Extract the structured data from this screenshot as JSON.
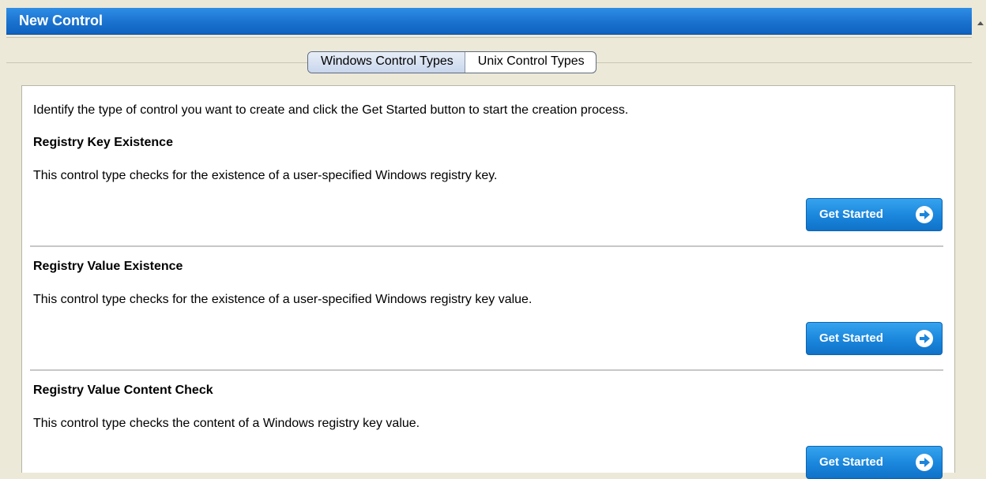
{
  "window": {
    "title": "New Control"
  },
  "tabs": [
    {
      "label": "Windows Control Types",
      "active": true
    },
    {
      "label": "Unix Control Types",
      "active": false
    }
  ],
  "intro": "Identify the type of control you want to create and click the Get Started button to start the creation process.",
  "controls": [
    {
      "heading": "Registry Key Existence",
      "description": "This control type checks for the existence of a user-specified Windows registry key.",
      "button_label": "Get Started"
    },
    {
      "heading": "Registry Value Existence",
      "description": "This control type checks for the existence of a user-specified Windows registry key value.",
      "button_label": "Get Started"
    },
    {
      "heading": "Registry Value Content Check",
      "description": "This control type checks the content of a Windows registry key value.",
      "button_label": "Get Started"
    }
  ],
  "icons": {
    "button_arrow": "arrow-circle-right-icon",
    "scroll": "scroll-up-icon"
  },
  "colors": {
    "titlebar": "#1a72cf",
    "button": "#1a86dc"
  }
}
